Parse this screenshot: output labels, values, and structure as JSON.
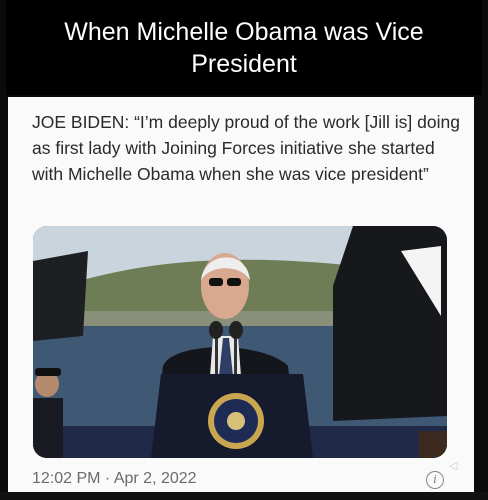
{
  "header": {
    "title": "When Michelle Obama was Vice President"
  },
  "tweet": {
    "text": "JOE BIDEN: “I’m deeply proud of the work [Jill is] doing as first lady with Joining Forces initiative she started with Michelle Obama when she was vice president”",
    "timestamp": "12:02 PM · Apr 2, 2022",
    "info_glyph": "i"
  },
  "media": {
    "description_icon": "video-thumbnail"
  },
  "colors": {
    "header_bg": "#000000",
    "card_bg": "#fafafa",
    "text": "#2a2a2a",
    "meta": "#6b6b6b"
  }
}
